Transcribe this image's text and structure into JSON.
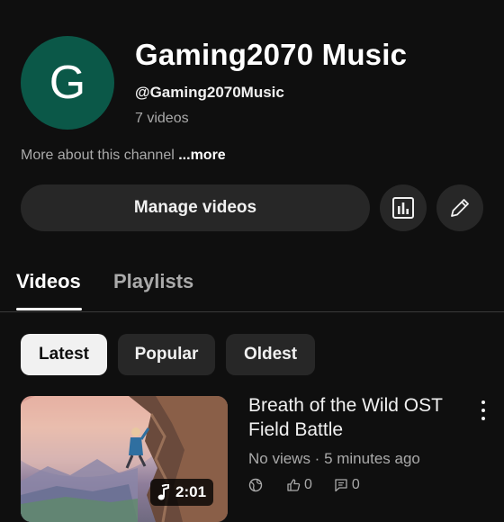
{
  "channel": {
    "avatar_letter": "G",
    "avatar_color": "#0b5848",
    "name": "Gaming2070 Music",
    "handle": "@Gaming2070Music",
    "video_count": "7 videos",
    "about_text": "More about this channel",
    "about_more": "...more"
  },
  "actions": {
    "manage_label": "Manage videos",
    "analytics_icon": "analytics-icon",
    "edit_icon": "pencil-icon"
  },
  "tabs": [
    {
      "label": "Videos",
      "selected": true
    },
    {
      "label": "Playlists",
      "selected": false
    }
  ],
  "filters": [
    {
      "label": "Latest",
      "selected": true
    },
    {
      "label": "Popular",
      "selected": false
    },
    {
      "label": "Oldest",
      "selected": false
    }
  ],
  "video": {
    "title": "Breath of the Wild OST Field Battle",
    "meta": "No views · 5 minutes ago",
    "duration": "2:01",
    "likes": "0",
    "comments": "0",
    "visibility_icon": "globe-icon",
    "music_icon": "music-note-icon"
  }
}
